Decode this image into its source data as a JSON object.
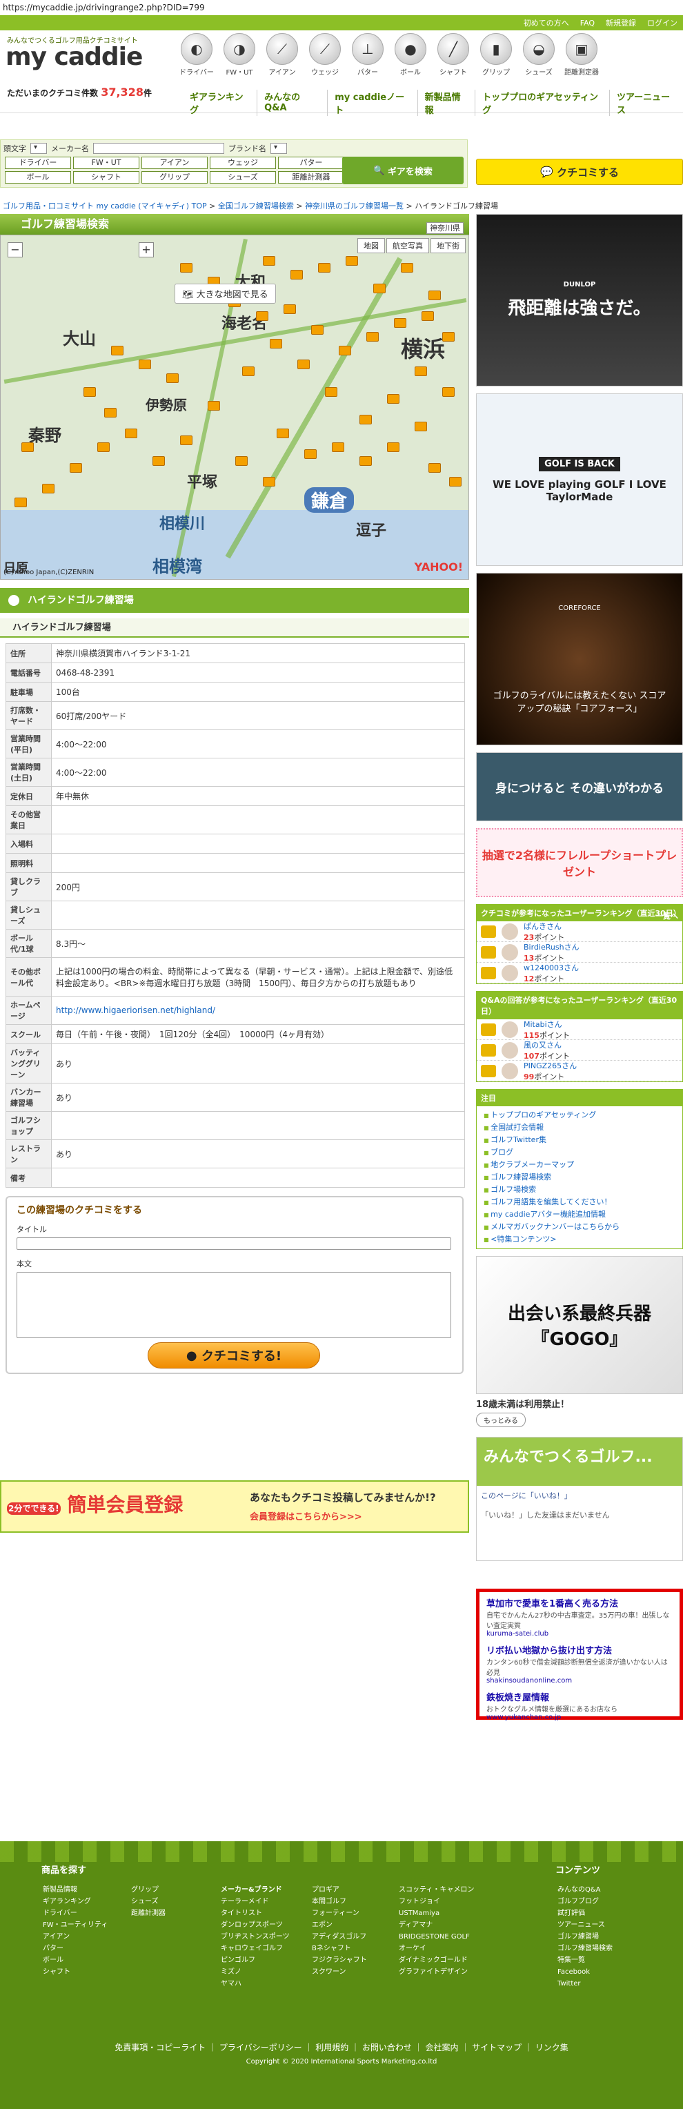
{
  "url": "https://mycaddie.jp/drivingrange2.php?DID=799",
  "topbar": {
    "links": [
      "初めての方へ",
      "FAQ",
      "新規登録",
      "ログイン"
    ]
  },
  "logo": {
    "sub": "みんなでつくるゴルフ用品クチコミサイト",
    "name": "my caddie",
    "count_label": "ただいまのクチコミ件数",
    "count": "37,328",
    "count_unit": "件"
  },
  "categories": [
    "ドライバー",
    "FW・UT",
    "アイアン",
    "ウェッジ",
    "パター",
    "ボール",
    "シャフト",
    "グリップ",
    "シューズ",
    "距離測定器"
  ],
  "gnav": [
    "ギアランキング",
    "みんなのQ&A",
    "my caddieノート",
    "新製品情報",
    "トッププロのギアセッティング",
    "ツアーニュース"
  ],
  "search": {
    "label_initial": "頭文字",
    "label_maker": "メーカー名",
    "label_brand": "ブランド名",
    "buttons": [
      "ドライバー",
      "FW・UT",
      "アイアン",
      "ウェッジ",
      "パター",
      "ボール",
      "シャフト",
      "グリップ",
      "シューズ",
      "距離計測器"
    ],
    "gear_button": "ギアを検索"
  },
  "kuchikomi_button": "クチコミする",
  "breadcrumb": [
    "ゴルフ用品・口コミサイト my caddie (マイキャディ) TOP",
    "全国ゴルフ練習場検索",
    "神奈川県のゴルフ練習場一覧",
    "ハイランドゴルフ練習場"
  ],
  "map": {
    "title": "ゴルフ練習場検索",
    "pref": "神奈川県",
    "tabs": [
      "地図",
      "航空写真",
      "地下街"
    ],
    "big_map": "大きな地図で見る",
    "cities": [
      "大和",
      "海老名",
      "大山",
      "伊勢原",
      "秦野",
      "平塚",
      "横浜",
      "鎌倉",
      "逗子",
      "相模川",
      "相模湾",
      "日原"
    ],
    "copyright": "(C)Yahoo Japan,(C)ZENRIN",
    "brand": "YAHOO!"
  },
  "section_title": "ハイランドゴルフ練習場",
  "sub_title": "ハイランドゴルフ練習場",
  "info": [
    {
      "k": "住所",
      "v": "神奈川県横須賀市ハイランド3-1-21"
    },
    {
      "k": "電話番号",
      "v": "0468-48-2391"
    },
    {
      "k": "駐車場",
      "v": "100台"
    },
    {
      "k": "打席数・ヤード",
      "v": "60打席/200ヤード"
    },
    {
      "k": "営業時間(平日)",
      "v": "4:00〜22:00"
    },
    {
      "k": "営業時間(土日)",
      "v": "4:00〜22:00"
    },
    {
      "k": "定休日",
      "v": "年中無休"
    },
    {
      "k": "その他営業日",
      "v": ""
    },
    {
      "k": "入場料",
      "v": ""
    },
    {
      "k": "照明料",
      "v": ""
    },
    {
      "k": "貸しクラブ",
      "v": "200円"
    },
    {
      "k": "貸しシューズ",
      "v": ""
    },
    {
      "k": "ボール代/1球",
      "v": "8.3円〜"
    },
    {
      "k": "その他ボール代",
      "v": "上記は1000円の場合の料金、時間帯によって異なる（早朝・サービス・通常）。上記は上限金額で、別途低料金設定あり。<BR>※毎週水曜日打ち放題（3時間　1500円）、毎日夕方からの打ち放題もあり"
    },
    {
      "k": "ホームページ",
      "v": "http://www.higaeriorisen.net/highland/"
    },
    {
      "k": "スクール",
      "v": "毎日（午前・午後・夜間）　1回120分（全4回）　10000円（4ヶ月有効）"
    },
    {
      "k": "バッティンググリーン",
      "v": "あり"
    },
    {
      "k": "バンカー練習場",
      "v": "あり"
    },
    {
      "k": "ゴルフショップ",
      "v": ""
    },
    {
      "k": "レストラン",
      "v": "あり"
    },
    {
      "k": "備考",
      "v": ""
    }
  ],
  "review": {
    "title": "この練習場のクチコミをする",
    "title_label": "タイトル",
    "body_label": "本文",
    "submit": "クチコミする!"
  },
  "register": {
    "badge": "2分でできる!",
    "title": "簡単会員登録",
    "lead": "あなたもクチコミ投稿してみませんか!?",
    "link": "会員登録はこちらから>>>"
  },
  "side": {
    "ad1": "飛距離は強さだ。",
    "ad1_brand": "DUNLOP",
    "ad2": "WE LOVE playing GOLF I LOVE TaylorMade",
    "ad2_tag": "GOLF IS BACK",
    "ad3": "ゴルフのライバルには教えたくない スコアアップの秘訣「コアフォース」",
    "ad3_brand": "COREFORCE",
    "ad4": "身につけると その違いがわかる",
    "ad5": "抽選で2名様にフレループショートプレゼント",
    "rank1_title": "クチコミが参考になったユーザーランキング（直近30日）",
    "rank1_more": "一覧へ",
    "rank1": [
      {
        "name": "ぱんきさん",
        "pt": "23",
        "unit": "ポイント"
      },
      {
        "name": "BirdieRushさん",
        "pt": "13",
        "unit": "ポイント"
      },
      {
        "name": "w1240003さん",
        "pt": "12",
        "unit": "ポイント"
      }
    ],
    "rank2_title": "Q&Aの回答が参考になったユーザーランキング（直近30日）",
    "rank2": [
      {
        "name": "Mitabiさん",
        "pt": "115",
        "unit": "ポイント"
      },
      {
        "name": "風の又さん",
        "pt": "107",
        "unit": "ポイント"
      },
      {
        "name": "PINGZ265さん",
        "pt": "99",
        "unit": "ポイント"
      }
    ],
    "notice_title": "注目",
    "notice": [
      "トッププロのギアセッティング",
      "全国試打会情報",
      "ゴルフTwitter集",
      "ブログ",
      "地クラブメーカーマップ",
      "ゴルフ練習場検索",
      "ゴルフ場検索",
      "ゴルフ用語集を編集してください！",
      "my caddieアバター機能追加情報",
      "メルマガバックナンバーはこちらから",
      "<特集コンテンツ>"
    ],
    "ad6": "出会い系最終兵器『GOGO』",
    "ad6_note": "18歳未満は利用禁止！",
    "ad6_more": "もっとみる",
    "fb_title": "みんなでつくるゴルフ...",
    "fb_like": "このページに「いいね！」",
    "fb_empty": "「いいね！」した友達はまだいません",
    "text_ads": [
      {
        "t": "草加市で愛車を1番高く売る方法",
        "d": "自宅でかんたん27秒の中古車査定。35万円の車！出張しない査定実質",
        "u": "kuruma-satei.club"
      },
      {
        "t": "リボ払い地獄から抜け出す方法",
        "d": "カンタン60秒で借金減額診断無償全返済が違いかない人は必見",
        "u": "shakinsoudanonline.com"
      },
      {
        "t": "鉄板焼き屋情報",
        "d": "おトクなグルメ情報を厳選にあるお店なら",
        "u": "www.yukanchan.co.jp"
      }
    ]
  },
  "footer": {
    "col1_title": "商品を探す",
    "col1a": [
      "新製品情報",
      "ギアランキング",
      "ドライバー",
      "FW・ユーティリティ",
      "アイアン",
      "パター",
      "ボール",
      "シャフト"
    ],
    "col1b": [
      "グリップ",
      "シューズ",
      "距離計測器"
    ],
    "col2_title": "メーカー&ブランド",
    "col2a": [
      "テーラーメイド",
      "タイトリスト",
      "ダンロップスポーツ",
      "ブリヂストンスポーツ",
      "キャロウェイゴルフ",
      "ピンゴルフ",
      "ミズノ",
      "ヤマハ"
    ],
    "col2b": [
      "プロギア",
      "本間ゴルフ",
      "フォーティーン",
      "エポン",
      "アディダスゴルフ",
      "Bネシャフト",
      "フジクラシャフト",
      "スクワーン"
    ],
    "col2c": [
      "スコッティ・キャメロン",
      "フットジョイ",
      "USTMamiya",
      "ディアマナ",
      "BRIDGESTONE GOLF",
      "オーケイ",
      "ダイナミックゴールド",
      "グラファイトデザイン"
    ],
    "col3_title": "コンテンツ",
    "col3": [
      "みんなのQ&A",
      "ゴルフブログ",
      "試打評価",
      "ツアーニュース",
      "ゴルフ練習場",
      "ゴルフ練習場検索",
      "特集一覧",
      "Facebook",
      "Twitter"
    ],
    "bottom_links": "免責事項・コピーライト ｜ プライバシーポリシー ｜ 利用規約 ｜ お問い合わせ ｜ 会社案内 ｜ サイトマップ ｜ リンク集",
    "copyright": "Copyright © 2020 International Sports Marketing,co.ltd"
  }
}
